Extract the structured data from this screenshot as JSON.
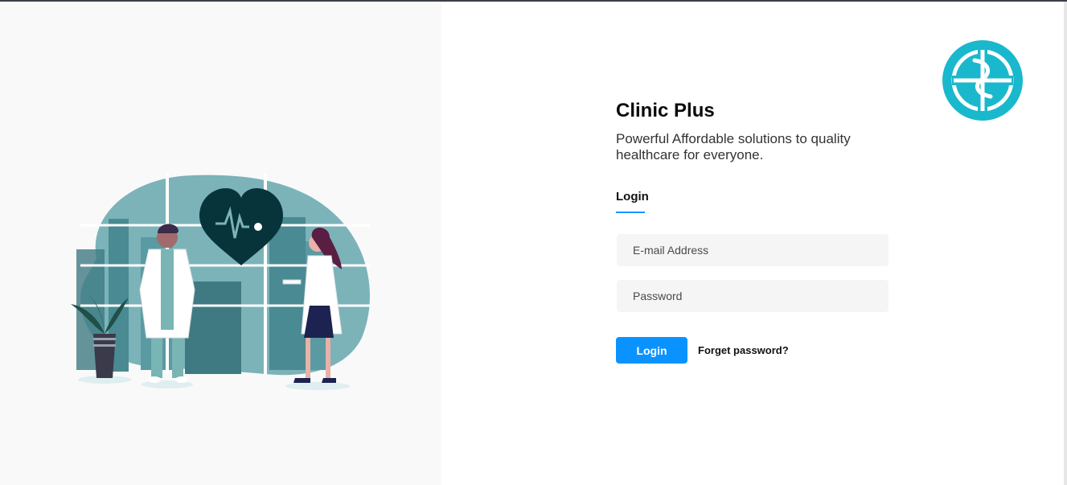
{
  "brand": {
    "title": "Clinic Plus",
    "tagline": "Powerful Affordable solutions to quality healthcare for everyone.",
    "logo_icon": "caduceus-logo-icon"
  },
  "tabs": [
    {
      "label": "Login",
      "active": true
    }
  ],
  "form": {
    "email_placeholder": "E-mail Address",
    "email_value": "",
    "password_placeholder": "Password",
    "password_value": "",
    "login_label": "Login",
    "forgot_label": "Forget password?"
  },
  "colors": {
    "accent": "#0a93ff",
    "teal": "#1ab8cc",
    "dark_teal": "#07343a"
  }
}
